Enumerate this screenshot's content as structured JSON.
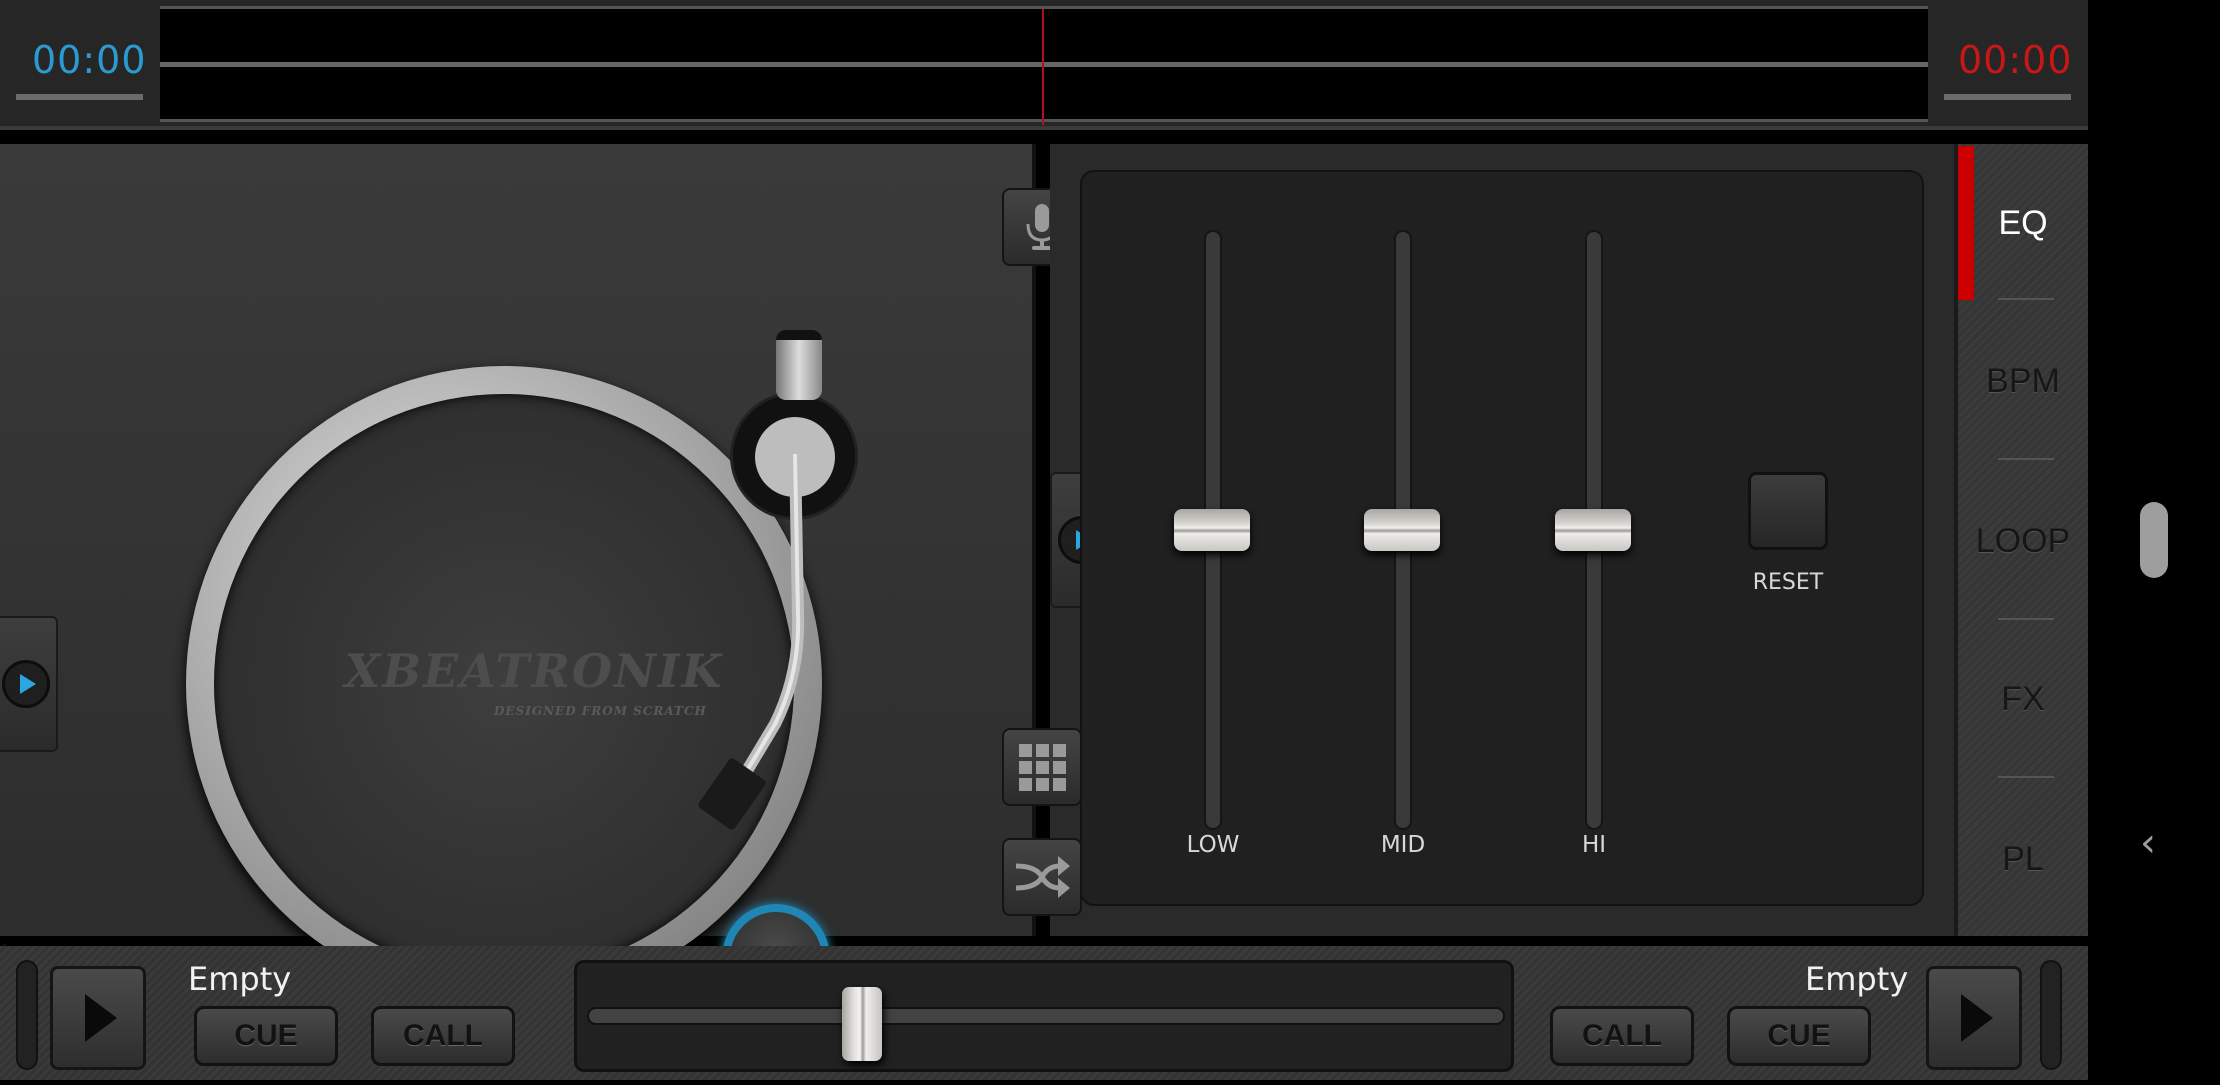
{
  "topbar": {
    "time_left": "00:00",
    "time_right": "00:00",
    "colors": {
      "time_left": "#2a9bd1",
      "time_right": "#c81717",
      "playhead": "#b01020"
    }
  },
  "deck": {
    "brand": "XBEATRONIK",
    "brand_tagline": "DESIGNED FROM SCRATCH",
    "icons": {
      "add_music": "music-note-plus-icon",
      "settings": "gears-icon",
      "mic": "microphone-icon",
      "grid": "grid-icon",
      "shuffle": "shuffle-icon",
      "side_play": "play-icon"
    }
  },
  "eq": {
    "faders": [
      {
        "label": "LOW",
        "value": 0.5
      },
      {
        "label": "MID",
        "value": 0.5
      },
      {
        "label": "HI",
        "value": 0.5
      }
    ],
    "reset_label": "RESET"
  },
  "tabs": [
    {
      "label": "EQ",
      "active": true
    },
    {
      "label": "BPM",
      "active": false
    },
    {
      "label": "LOOP",
      "active": false
    },
    {
      "label": "FX",
      "active": false
    },
    {
      "label": "PL",
      "active": false
    }
  ],
  "bottom": {
    "left_deck": {
      "track": "Empty",
      "cue": "CUE",
      "call": "CALL"
    },
    "right_deck": {
      "track": "Empty",
      "cue": "CUE",
      "call": "CALL"
    },
    "crossfader_value": 0.3
  },
  "system_nav": {
    "back": "‹"
  }
}
